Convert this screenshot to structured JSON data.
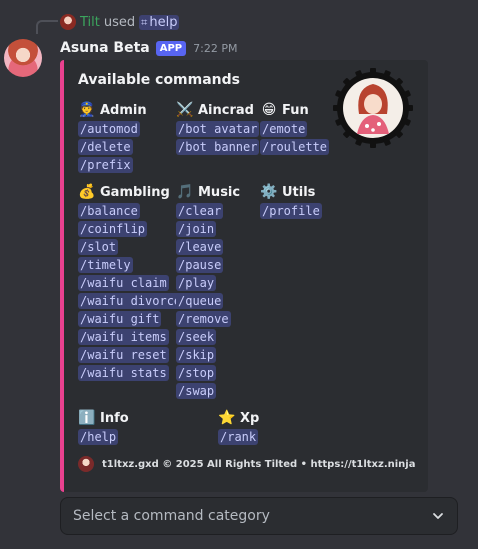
{
  "reply": {
    "username": "Tilt",
    "used_text": "used",
    "command_icon": "slash-command-icon",
    "command": "help"
  },
  "bot": {
    "name": "Asuna Beta",
    "badge": "APP",
    "time": "7:22 PM"
  },
  "embed": {
    "accent_color": "#e9418f",
    "title": "Available commands",
    "fields": [
      {
        "emoji": "👮",
        "name": "Admin",
        "commands": [
          "/automod",
          "/delete",
          "/prefix"
        ]
      },
      {
        "emoji": "⚔️",
        "name": "Aincrad",
        "commands": [
          "/bot avatar",
          "/bot banner"
        ]
      },
      {
        "emoji": "😁",
        "name": "Fun",
        "commands": [
          "/emote",
          "/roulette"
        ]
      },
      {
        "emoji": "💰",
        "name": "Gambling",
        "commands": [
          "/balance",
          "/coinflip",
          "/slot",
          "/timely",
          "/waifu claim",
          "/waifu divorce",
          "/waifu gift",
          "/waifu items",
          "/waifu reset",
          "/waifu stats"
        ]
      },
      {
        "emoji": "🎵",
        "name": "Music",
        "commands": [
          "/clear",
          "/join",
          "/leave",
          "/pause",
          "/play",
          "/queue",
          "/remove",
          "/seek",
          "/skip",
          "/stop",
          "/swap"
        ]
      },
      {
        "emoji": "⚙️",
        "name": "Utils",
        "commands": [
          "/profile"
        ]
      },
      {
        "emoji": "ℹ️",
        "name": "Info",
        "commands": [
          "/help"
        ]
      },
      {
        "emoji": "⭐",
        "name": "Xp",
        "commands": [
          "/rank"
        ]
      }
    ],
    "footer": "t1ltxz.gxd © 2025 All Rights Tilted • https://t1ltxz.ninja"
  },
  "select": {
    "placeholder": "Select a command category",
    "icon": "chevron-down-icon"
  },
  "colors": {
    "background": "#323339",
    "embed_bg": "#2b2d31",
    "code_bg": "#3c4270",
    "code_text": "#c9cdfb",
    "app_badge": "#5865f2",
    "username_green": "#3ba55d"
  }
}
